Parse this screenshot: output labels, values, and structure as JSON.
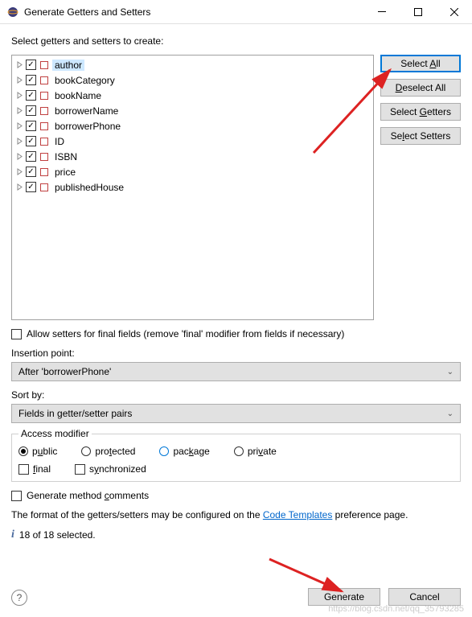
{
  "window": {
    "title": "Generate Getters and Setters"
  },
  "instruction": "Select getters and setters to create:",
  "fields": [
    {
      "name": "author",
      "selected": true
    },
    {
      "name": "bookCategory",
      "selected": false
    },
    {
      "name": "bookName",
      "selected": false
    },
    {
      "name": "borrowerName",
      "selected": false
    },
    {
      "name": "borrowerPhone",
      "selected": false
    },
    {
      "name": "ID",
      "selected": false
    },
    {
      "name": "ISBN",
      "selected": false
    },
    {
      "name": "price",
      "selected": false
    },
    {
      "name": "publishedHouse",
      "selected": false
    }
  ],
  "buttons": {
    "select_all": "Select All",
    "deselect_all": "Deselect All",
    "select_getters": "Select Getters",
    "select_setters": "Select Setters",
    "generate": "Generate",
    "cancel": "Cancel"
  },
  "allow_setters_final": {
    "label": "Allow setters for final fields (remove 'final' modifier from fields if necessary)",
    "checked": false
  },
  "insertion_point": {
    "label": "Insertion point:",
    "value": "After 'borrowerPhone'"
  },
  "sort_by": {
    "label": "Sort by:",
    "value": "Fields in getter/setter pairs"
  },
  "access_modifier": {
    "legend": "Access modifier",
    "options": [
      "public",
      "protected",
      "package",
      "private"
    ],
    "selected": "public",
    "final": {
      "label": "final",
      "checked": false
    },
    "synchronized": {
      "label": "synchronized",
      "checked": false
    }
  },
  "generate_comments": {
    "label": "Generate method comments",
    "checked": false
  },
  "format_text_pre": "The format of the getters/setters may be configured on the ",
  "format_link": "Code Templates",
  "format_text_post": " preference page.",
  "status": "18 of 18 selected.",
  "watermark": "https://blog.csdn.net/qq_35793285"
}
